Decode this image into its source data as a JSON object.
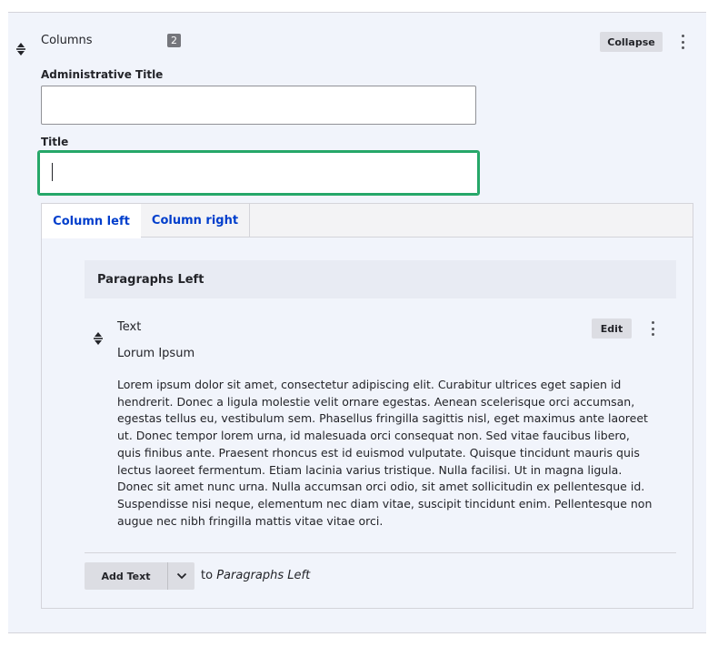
{
  "paragraph": {
    "type_label": "Columns",
    "count_badge": "2",
    "collapse_label": "Collapse"
  },
  "fields": {
    "admin_title": {
      "label": "Administrative Title",
      "value": ""
    },
    "title": {
      "label": "Title",
      "value": ""
    }
  },
  "tabs": [
    {
      "label": "Column left",
      "active": true
    },
    {
      "label": "Column right",
      "active": false
    }
  ],
  "column_left": {
    "group_title": "Paragraphs Left",
    "item": {
      "type_label": "Text",
      "title": "Lorum Ipsum",
      "edit_label": "Edit",
      "body": "Lorem ipsum dolor sit amet, consectetur adipiscing elit. Curabitur ultrices eget sapien id hendrerit. Donec a ligula molestie velit ornare egestas. Aenean scelerisque orci accumsan, egestas tellus eu, vestibulum sem. Phasellus fringilla sagittis nisl, eget maximus ante laoreet ut. Donec tempor lorem urna, id malesuada orci consequat non. Sed vitae faucibus libero, quis finibus ante. Praesent rhoncus est id euismod vulputate. Quisque tincidunt mauris quis lectus laoreet fermentum. Etiam lacinia varius tristique. Nulla facilisi. Ut in magna ligula. Donec sit amet nunc urna. Nulla accumsan orci odio, sit amet sollicitudin ex pellentesque id. Suspendisse nisi neque, elementum nec diam vitae, suscipit tincidunt enim. Pellentesque non augue nec nibh fringilla mattis vitae vitae orci."
    },
    "add": {
      "button_label": "Add Text",
      "to_prefix": "to",
      "to_target": "Paragraphs Left"
    }
  },
  "icons": {
    "drag": "drag-handle-icon",
    "more": "kebab-menu-icon",
    "dropdown": "chevron-down-icon"
  },
  "colors": {
    "panel_bg": "#f1f4fb",
    "focus_border": "#26a769",
    "tab_link": "#003ecc",
    "button_bg": "#dcdde3",
    "badge_bg": "#75767c"
  }
}
